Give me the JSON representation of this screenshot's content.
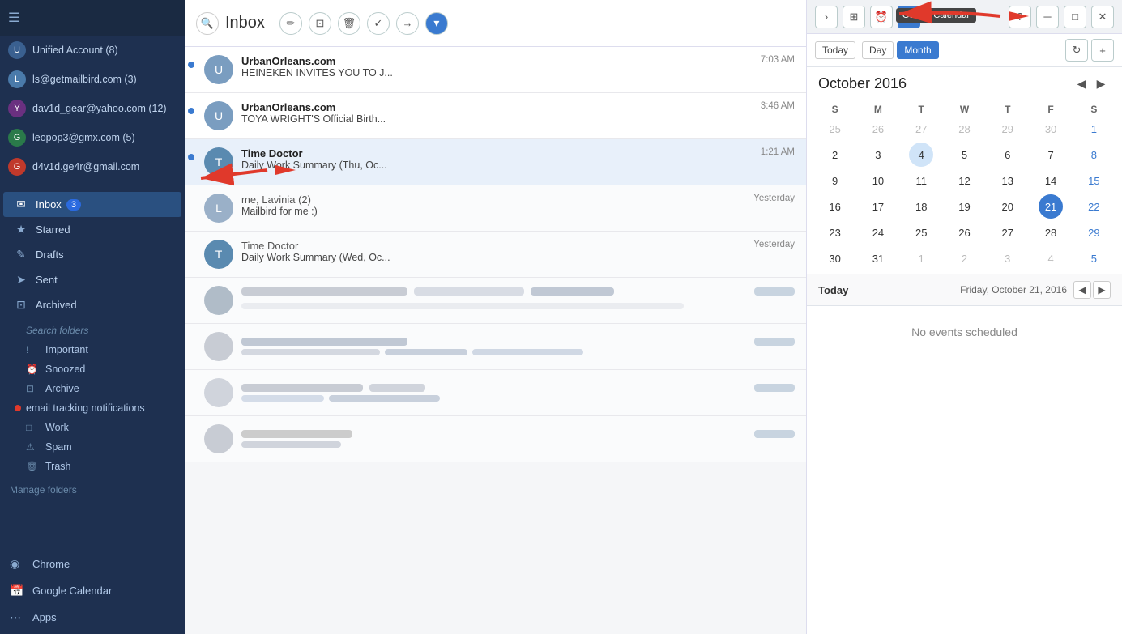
{
  "sidebar": {
    "hamburger": "☰",
    "accounts": [
      {
        "id": "unified",
        "label": "Unified Account (8)",
        "initials": "U",
        "badge": "(8)",
        "avatarClass": "unified"
      },
      {
        "id": "ls",
        "label": "ls@getmailbird.com (3)",
        "initials": "L",
        "badge": "(3)",
        "avatarClass": ""
      },
      {
        "id": "dav",
        "label": "dav1d_gear@yahoo.com (12)",
        "initials": "Y",
        "badge": "(12)",
        "avatarClass": "ys"
      },
      {
        "id": "leo",
        "label": "leopop3@gmx.com (5)",
        "initials": "G",
        "badge": "(5)",
        "avatarClass": ""
      },
      {
        "id": "d4v",
        "label": "d4v1d.ge4r@gmail.com",
        "initials": "G",
        "badge": "",
        "avatarClass": "gm"
      }
    ],
    "nav": [
      {
        "id": "inbox",
        "label": "Inbox",
        "icon": "✉",
        "badge": "3",
        "active": true
      },
      {
        "id": "starred",
        "label": "Starred",
        "icon": "★",
        "badge": ""
      },
      {
        "id": "drafts",
        "label": "Drafts",
        "icon": "✎",
        "badge": ""
      },
      {
        "id": "sent",
        "label": "Sent",
        "icon": "➤",
        "badge": ""
      },
      {
        "id": "archived",
        "label": "Archived",
        "icon": "⊡",
        "badge": ""
      }
    ],
    "search_folders": "Search folders",
    "folders": [
      {
        "id": "important",
        "label": "Important",
        "icon": "!",
        "special": ""
      },
      {
        "id": "snoozed",
        "label": "Snoozed",
        "icon": "🕐",
        "special": ""
      },
      {
        "id": "archive",
        "label": "Archive",
        "icon": "⊡",
        "special": ""
      },
      {
        "id": "email-tracking",
        "label": "email tracking notifications",
        "icon": "",
        "special": "red-dot"
      },
      {
        "id": "work",
        "label": "Work",
        "icon": "□",
        "special": ""
      },
      {
        "id": "spam",
        "label": "Spam",
        "icon": "",
        "special": ""
      },
      {
        "id": "trash",
        "label": "Trash",
        "icon": "🗑",
        "special": ""
      }
    ],
    "manage_folders": "Manage folders",
    "bottom": [
      {
        "id": "chrome",
        "label": "Chrome",
        "icon": "◉"
      },
      {
        "id": "google-calendar",
        "label": "Google Calendar",
        "icon": "📅"
      },
      {
        "id": "apps",
        "label": "Apps",
        "icon": "⋯"
      }
    ]
  },
  "email_list": {
    "title": "Inbox",
    "emails": [
      {
        "id": 1,
        "from": "UrbanOrleans.com",
        "subject": "HEINEKEN INVITES YOU TO J...",
        "preview": "",
        "time": "7:03 AM",
        "unread": true,
        "avatarColor": "#7a9dc0",
        "initials": "U"
      },
      {
        "id": 2,
        "from": "UrbanOrleans.com",
        "subject": "TOYA WRIGHT'S Official Birth...",
        "preview": "",
        "time": "3:46 AM",
        "unread": true,
        "avatarColor": "#7a9dc0",
        "initials": "U"
      },
      {
        "id": 3,
        "from": "Time Doctor",
        "subject": "Daily Work Summary (Thu, Oc...",
        "preview": "",
        "time": "1:21 AM",
        "unread": true,
        "avatarColor": "#5a8ab0",
        "initials": "T"
      },
      {
        "id": 4,
        "from": "me, Lavinia (2)",
        "subject": "Mailbird for me :)",
        "preview": "",
        "time": "Yesterday",
        "unread": false,
        "avatarColor": "#9ab0c8",
        "initials": "L"
      },
      {
        "id": 5,
        "from": "Time Doctor",
        "subject": "Daily Work Summary (Wed, Oc...",
        "preview": "",
        "time": "Yesterday",
        "unread": false,
        "avatarColor": "#5a8ab0",
        "initials": "T"
      }
    ]
  },
  "calendar": {
    "title": "Google Calendar",
    "month_year": "October 2016",
    "view_today": "Today",
    "view_day": "Day",
    "view_month": "Month",
    "tooltip": "Google Calendar",
    "day_headers": [
      "S",
      "M",
      "T",
      "W",
      "T",
      "F",
      "S"
    ],
    "weeks": [
      [
        {
          "day": "25",
          "other": true
        },
        {
          "day": "26",
          "other": true
        },
        {
          "day": "27",
          "other": true
        },
        {
          "day": "28",
          "other": true
        },
        {
          "day": "29",
          "other": true
        },
        {
          "day": "30",
          "other": true
        },
        {
          "day": "1",
          "saturday": true
        }
      ],
      [
        {
          "day": "2"
        },
        {
          "day": "3"
        },
        {
          "day": "4",
          "highlight": true
        },
        {
          "day": "5"
        },
        {
          "day": "6"
        },
        {
          "day": "7"
        },
        {
          "day": "8",
          "saturday": true
        }
      ],
      [
        {
          "day": "9"
        },
        {
          "day": "10"
        },
        {
          "day": "11"
        },
        {
          "day": "12"
        },
        {
          "day": "13"
        },
        {
          "day": "14"
        },
        {
          "day": "15",
          "saturday": true
        }
      ],
      [
        {
          "day": "16"
        },
        {
          "day": "17"
        },
        {
          "day": "18"
        },
        {
          "day": "19"
        },
        {
          "day": "20"
        },
        {
          "day": "21",
          "today": true,
          "saturday_blue": true
        },
        {
          "day": "22",
          "saturday": true
        }
      ],
      [
        {
          "day": "23"
        },
        {
          "day": "24"
        },
        {
          "day": "25"
        },
        {
          "day": "26"
        },
        {
          "day": "27"
        },
        {
          "day": "28"
        },
        {
          "day": "29",
          "saturday": true
        }
      ],
      [
        {
          "day": "30"
        },
        {
          "day": "31"
        },
        {
          "day": "1",
          "other": true
        },
        {
          "day": "2",
          "other": true
        },
        {
          "day": "3",
          "other": true
        },
        {
          "day": "4",
          "other": true
        },
        {
          "day": "5",
          "other": true,
          "saturday": true
        }
      ]
    ],
    "today_label": "Today",
    "today_date": "Friday, October 21, 2016",
    "no_events": "No events scheduled"
  }
}
